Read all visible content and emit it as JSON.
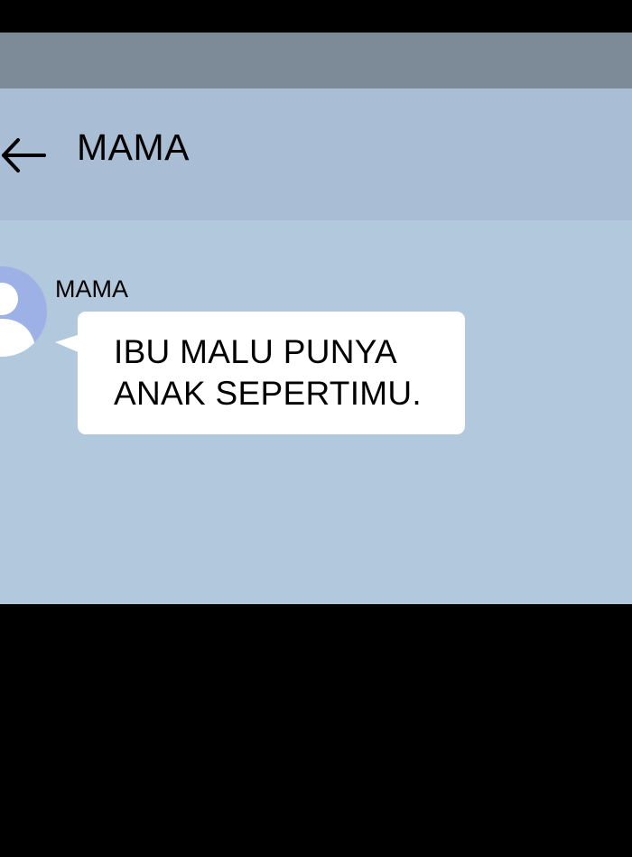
{
  "header": {
    "title": "MAMA",
    "back_icon": "arrow-left-icon"
  },
  "conversation": {
    "messages": [
      {
        "sender": "MAMA",
        "avatar_icon": "default-user-avatar-icon",
        "lines": [
          "IBU MALU PUNYA",
          "ANAK SEPERTIMU."
        ]
      }
    ]
  },
  "colors": {
    "status_bar": "#7d8b99",
    "header_background": "#a9bdd4",
    "chat_background": "#b2c8dd",
    "bubble_background": "#ffffff",
    "avatar_background": "#9db1e6",
    "letterbox": "#000000"
  }
}
